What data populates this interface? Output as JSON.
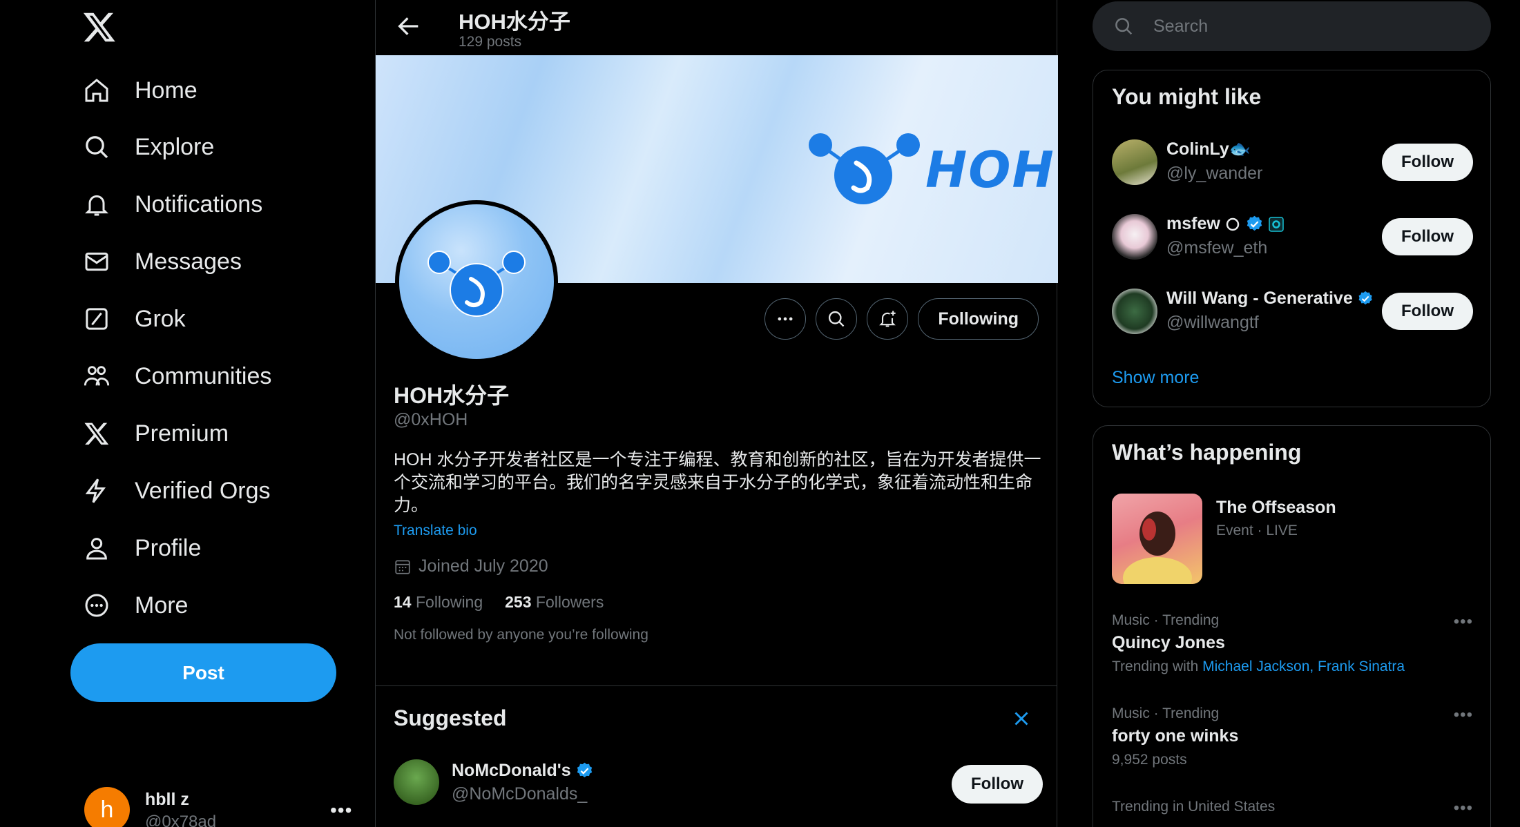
{
  "nav": {
    "items": [
      {
        "label": "Home",
        "icon": "home-icon"
      },
      {
        "label": "Explore",
        "icon": "search-icon"
      },
      {
        "label": "Notifications",
        "icon": "bell-icon"
      },
      {
        "label": "Messages",
        "icon": "mail-icon"
      },
      {
        "label": "Grok",
        "icon": "grok-icon"
      },
      {
        "label": "Communities",
        "icon": "communities-icon"
      },
      {
        "label": "Premium",
        "icon": "x-icon"
      },
      {
        "label": "Verified Orgs",
        "icon": "lightning-icon"
      },
      {
        "label": "Profile",
        "icon": "person-icon"
      },
      {
        "label": "More",
        "icon": "more-circle-icon"
      }
    ],
    "post_label": "Post"
  },
  "account": {
    "initial": "h",
    "name": "hbll z",
    "handle": "@0x78ad"
  },
  "header": {
    "title": "HOH水分子",
    "posts_count": "129 posts"
  },
  "banner": {
    "logo_text": "HOH"
  },
  "profile": {
    "name": "HOH水分子",
    "handle": "@0xHOH",
    "bio": "HOH 水分子开发者社区是一个专注于编程、教育和创新的社区，旨在为开发者提供一个交流和学习的平台。我们的名字灵感来自于水分子的化学式，象征着流动性和生命力。",
    "translate_label": "Translate bio",
    "joined": "Joined July 2020",
    "following_count": "14",
    "following_label": "Following",
    "followers_count": "253",
    "followers_label": "Followers",
    "not_followed": "Not followed by anyone you’re following",
    "following_button": "Following"
  },
  "suggested": {
    "title": "Suggested",
    "items": [
      {
        "name": "NoMcDonald's",
        "handle": "@NoMcDonalds_",
        "verified": true,
        "button": "Follow"
      }
    ]
  },
  "search": {
    "placeholder": "Search"
  },
  "you_might_like": {
    "title": "You might like",
    "items": [
      {
        "name": "ColinLy🐟",
        "handle": "@ly_wander",
        "button": "Follow"
      },
      {
        "name": "msfew",
        "handle": "@msfew_eth",
        "button": "Follow"
      },
      {
        "name": "Will Wang - Generative",
        "handle": "@willwangtf",
        "button": "Follow"
      }
    ],
    "show_more": "Show more"
  },
  "whats_happening": {
    "title": "What’s happening",
    "event": {
      "title": "The Offseason",
      "meta": "Event · LIVE"
    },
    "trends": [
      {
        "meta": "Music · Trending",
        "name": "Quincy Jones",
        "extra_prefix": "Trending with",
        "extra_links": "Michael Jackson, Frank Sinatra"
      },
      {
        "meta": "Music · Trending",
        "name": "forty one winks",
        "extra": "9,952 posts"
      },
      {
        "meta": "Trending in United States",
        "name": ""
      }
    ]
  },
  "colors": {
    "accent": "#1d9bf0",
    "background": "#000000",
    "muted": "#71767b",
    "border": "#2f3336"
  }
}
